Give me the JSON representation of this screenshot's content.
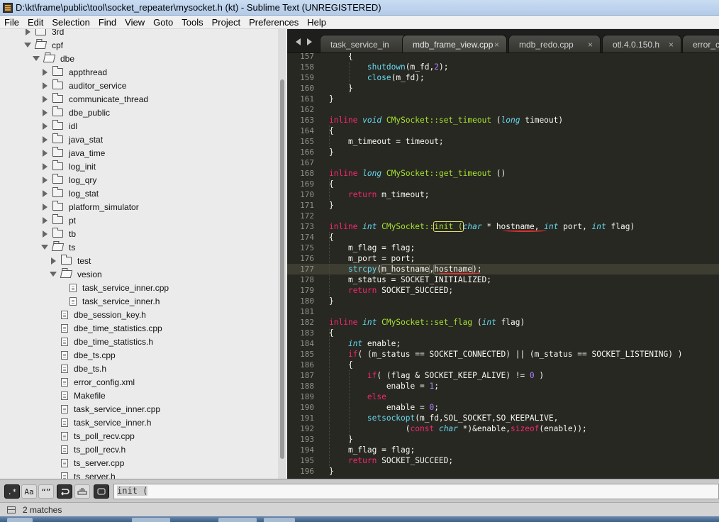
{
  "window": {
    "title": "D:\\kt\\frame\\public\\tool\\socket_repeater\\mysocket.h (kt) - Sublime Text (UNREGISTERED)"
  },
  "menu": [
    "File",
    "Edit",
    "Selection",
    "Find",
    "View",
    "Goto",
    "Tools",
    "Project",
    "Preferences",
    "Help"
  ],
  "sidebar": {
    "items": [
      {
        "label": "3rd",
        "kind": "folder",
        "depth": 1,
        "expanded": false
      },
      {
        "label": "cpf",
        "kind": "folder",
        "depth": 1,
        "expanded": true
      },
      {
        "label": "dbe",
        "kind": "folder",
        "depth": 2,
        "expanded": true
      },
      {
        "label": "appthread",
        "kind": "folder",
        "depth": 3,
        "expanded": false
      },
      {
        "label": "auditor_service",
        "kind": "folder",
        "depth": 3,
        "expanded": false
      },
      {
        "label": "communicate_thread",
        "kind": "folder",
        "depth": 3,
        "expanded": false
      },
      {
        "label": "dbe_public",
        "kind": "folder",
        "depth": 3,
        "expanded": false
      },
      {
        "label": "idl",
        "kind": "folder",
        "depth": 3,
        "expanded": false
      },
      {
        "label": "java_stat",
        "kind": "folder",
        "depth": 3,
        "expanded": false
      },
      {
        "label": "java_time",
        "kind": "folder",
        "depth": 3,
        "expanded": false
      },
      {
        "label": "log_init",
        "kind": "folder",
        "depth": 3,
        "expanded": false
      },
      {
        "label": "log_qry",
        "kind": "folder",
        "depth": 3,
        "expanded": false
      },
      {
        "label": "log_stat",
        "kind": "folder",
        "depth": 3,
        "expanded": false
      },
      {
        "label": "platform_simulator",
        "kind": "folder",
        "depth": 3,
        "expanded": false
      },
      {
        "label": "pt",
        "kind": "folder",
        "depth": 3,
        "expanded": false
      },
      {
        "label": "tb",
        "kind": "folder",
        "depth": 3,
        "expanded": false
      },
      {
        "label": "ts",
        "kind": "folder",
        "depth": 3,
        "expanded": true
      },
      {
        "label": "test",
        "kind": "folder",
        "depth": 4,
        "expanded": false
      },
      {
        "label": "vesion",
        "kind": "folder",
        "depth": 4,
        "expanded": true
      },
      {
        "label": "task_service_inner.cpp",
        "kind": "file",
        "depth": 5
      },
      {
        "label": "task_service_inner.h",
        "kind": "file",
        "depth": 5
      },
      {
        "label": "dbe_session_key.h",
        "kind": "file",
        "depth": 4
      },
      {
        "label": "dbe_time_statistics.cpp",
        "kind": "file",
        "depth": 4
      },
      {
        "label": "dbe_time_statistics.h",
        "kind": "file",
        "depth": 4
      },
      {
        "label": "dbe_ts.cpp",
        "kind": "file",
        "depth": 4
      },
      {
        "label": "dbe_ts.h",
        "kind": "file",
        "depth": 4
      },
      {
        "label": "error_config.xml",
        "kind": "file",
        "depth": 4
      },
      {
        "label": "Makefile",
        "kind": "file",
        "depth": 4
      },
      {
        "label": "task_service_inner.cpp",
        "kind": "file",
        "depth": 4
      },
      {
        "label": "task_service_inner.h",
        "kind": "file",
        "depth": 4
      },
      {
        "label": "ts_poll_recv.cpp",
        "kind": "file",
        "depth": 4
      },
      {
        "label": "ts_poll_recv.h",
        "kind": "file",
        "depth": 4
      },
      {
        "label": "ts_server.cpp",
        "kind": "file",
        "depth": 4
      },
      {
        "label": "ts_server.h",
        "kind": "file",
        "depth": 4
      }
    ]
  },
  "tabs": [
    {
      "label": "task_service_in",
      "close": ""
    },
    {
      "label": "mdb_frame_view.cpp",
      "close": "×"
    },
    {
      "label": "mdb_redo.cpp",
      "close": "×"
    },
    {
      "label": "otl.4.0.150.h",
      "close": "×"
    },
    {
      "label": "error_co",
      "close": ""
    }
  ],
  "editor": {
    "active_line": 177,
    "lines": [
      {
        "no": "157",
        "html": "    <span>{</span>"
      },
      {
        "no": "158",
        "html": "        <span class=\"c\">shutdown</span>(m_fd,<span class=\"n\">2</span>);"
      },
      {
        "no": "159",
        "html": "        <span class=\"c\">close</span>(m_fd);"
      },
      {
        "no": "160",
        "html": "    }"
      },
      {
        "no": "161",
        "html": "}"
      },
      {
        "no": "162",
        "html": ""
      },
      {
        "no": "163",
        "html": "<span class=\"k\">inline</span> <span class=\"t\">void</span> <span class=\"f\">CMySocket::set_timeout</span> (<span class=\"t\">long</span> timeout)"
      },
      {
        "no": "164",
        "html": "{"
      },
      {
        "no": "165",
        "html": "    m_timeout = timeout;"
      },
      {
        "no": "166",
        "html": "}"
      },
      {
        "no": "167",
        "html": ""
      },
      {
        "no": "168",
        "html": "<span class=\"k\">inline</span> <span class=\"t\">long</span> <span class=\"f\">CMySocket::get_timeout</span> ()"
      },
      {
        "no": "169",
        "html": "{"
      },
      {
        "no": "170",
        "html": "    <span class=\"k\">return</span> m_timeout;"
      },
      {
        "no": "171",
        "html": "}"
      },
      {
        "no": "172",
        "html": ""
      },
      {
        "no": "173",
        "html": "<span class=\"k\">inline</span> <span class=\"t\">int</span> <span class=\"f\">CMySocket::<span class=\"hl\">init (</span></span><span class=\"t\">char</span> * hostname, <span class=\"t\">int</span> port, <span class=\"t\">int</span> flag)"
      },
      {
        "no": "174",
        "html": "{"
      },
      {
        "no": "175",
        "html": "    m_flag = flag;"
      },
      {
        "no": "176",
        "html": "    m_port = port;"
      },
      {
        "no": "177",
        "html": "    <span class=\"c\">strcpy</span>(<span class=\"hl2\">m_hostname</span>,<span class=\"hl2\">hostname</span>);"
      },
      {
        "no": "178",
        "html": "    m_status = SOCKET_INITIALIZED;"
      },
      {
        "no": "179",
        "html": "    <span class=\"k\">return</span> SOCKET_SUCCEED;"
      },
      {
        "no": "180",
        "html": "}"
      },
      {
        "no": "181",
        "html": ""
      },
      {
        "no": "182",
        "html": "<span class=\"k\">inline</span> <span class=\"t\">int</span> <span class=\"f\">CMySocket::set_flag</span> (<span class=\"t\">int</span> flag)"
      },
      {
        "no": "183",
        "html": "{"
      },
      {
        "no": "184",
        "html": "    <span class=\"t\">int</span> enable;"
      },
      {
        "no": "185",
        "html": "    <span class=\"k\">if</span>( (m_status == SOCKET_CONNECTED) || (m_status == SOCKET_LISTENING) )"
      },
      {
        "no": "186",
        "html": "    {"
      },
      {
        "no": "187",
        "html": "        <span class=\"k\">if</span>( (flag &amp; SOCKET_KEEP_ALIVE) != <span class=\"n\">0</span> )"
      },
      {
        "no": "188",
        "html": "            enable = <span class=\"n\">1</span>;"
      },
      {
        "no": "189",
        "html": "        <span class=\"k\">else</span>"
      },
      {
        "no": "190",
        "html": "            enable = <span class=\"n\">0</span>;"
      },
      {
        "no": "191",
        "html": "        <span class=\"c\">setsockopt</span>(m_fd,SOL_SOCKET,SO_KEEPALIVE,"
      },
      {
        "no": "192",
        "html": "                (<span class=\"k\">const</span> <span class=\"t\">char</span> *)&amp;enable,<span class=\"k\">sizeof</span>(enable));"
      },
      {
        "no": "193",
        "html": "    }"
      },
      {
        "no": "194",
        "html": "    m_flag = flag;"
      },
      {
        "no": "195",
        "html": "    <span class=\"k\">return</span> SOCKET_SUCCEED;"
      },
      {
        "no": "196",
        "html": "}"
      }
    ]
  },
  "find": {
    "regex_label": ".*",
    "case_label": "Aa",
    "word_label": "“”",
    "query": "init ("
  },
  "status": {
    "text": "2 matches"
  }
}
